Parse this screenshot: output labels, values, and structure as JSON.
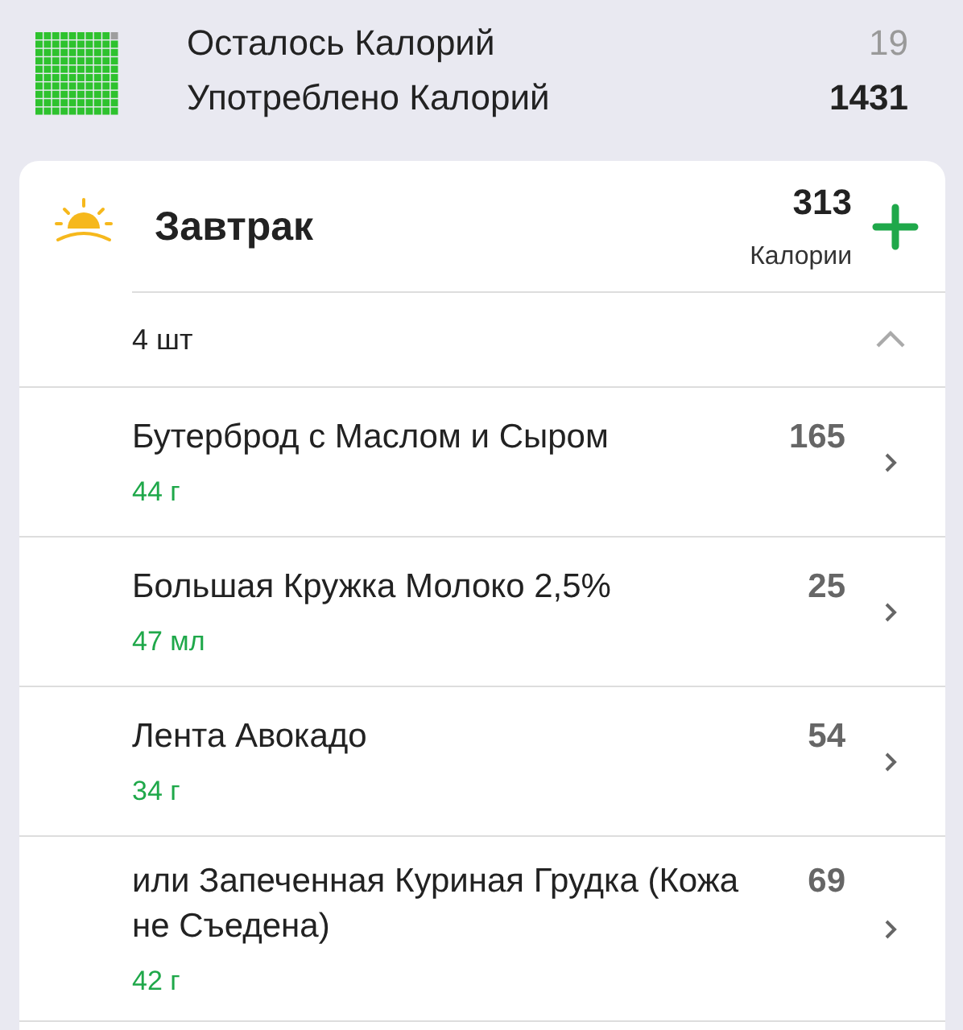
{
  "summary": [
    {
      "label": "Осталось Калорий",
      "value": "19",
      "kind": "remaining"
    },
    {
      "label": "Употреблено Калорий",
      "value": "1431",
      "kind": "consumed"
    }
  ],
  "meal": {
    "title": "Завтрак",
    "calories": "313",
    "calories_label": "Калории",
    "count": "4 шт",
    "expanded": true,
    "items": [
      {
        "name": "Бутерброд с Маслом и Сыром",
        "calories": "165",
        "amount": "44 г"
      },
      {
        "name": "Большая Кружка Молоко 2,5%",
        "calories": "25",
        "amount": "47 мл"
      },
      {
        "name": "Лента Авокадо",
        "calories": "54",
        "amount": "34 г"
      },
      {
        "name": "или Запеченная Куриная Грудка (Кожа не Съедена)",
        "calories": "69",
        "amount": "42 г"
      }
    ]
  }
}
